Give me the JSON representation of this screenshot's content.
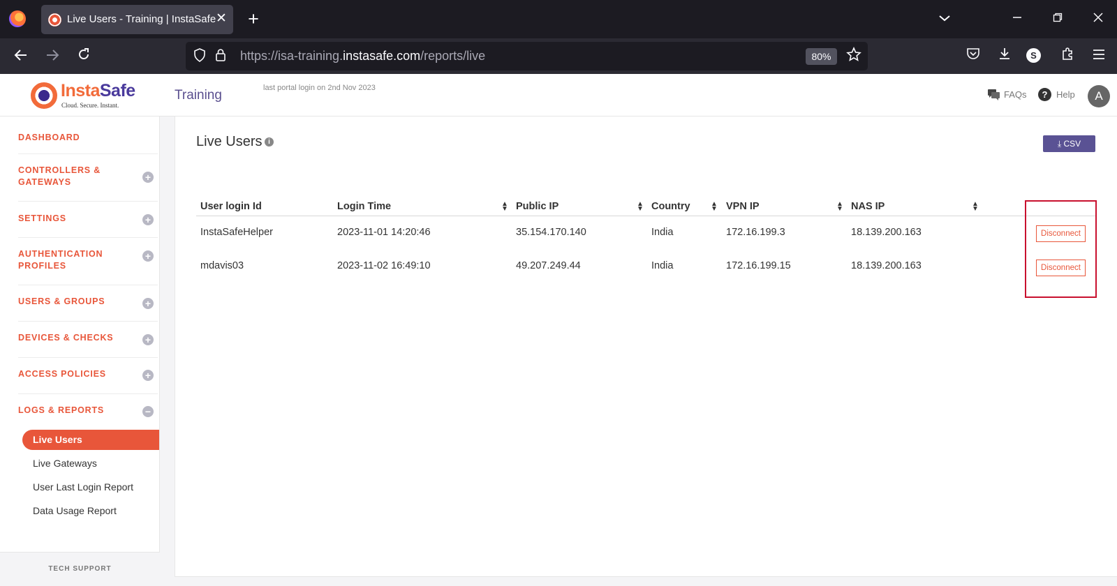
{
  "browser": {
    "tab_title": "Live Users - Training | InstaSafe",
    "tab_close": "✕",
    "new_tab": "+",
    "url_prefix": "https://isa-training.",
    "url_host": "instasafe.com",
    "url_path": "/reports/live",
    "zoom": "80%",
    "profile_initial": "S"
  },
  "header": {
    "logo_insta": "Insta",
    "logo_safe": "Safe",
    "logo_tagline": "Cloud. Secure. Instant.",
    "portal_title": "Training",
    "last_login": "last portal login on 2nd Nov 2023",
    "faqs_label": "FAQs",
    "help_label": "Help",
    "help_glyph": "?",
    "avatar_initial": "A"
  },
  "sidebar": {
    "items": [
      {
        "label": "DASHBOARD"
      },
      {
        "label": "CONTROLLERS &",
        "label2": "GATEWAYS"
      },
      {
        "label": "SETTINGS"
      },
      {
        "label": "AUTHENTICATION",
        "label2": "PROFILES"
      },
      {
        "label": "USERS & GROUPS"
      },
      {
        "label": "DEVICES & CHECKS"
      },
      {
        "label": "ACCESS POLICIES"
      },
      {
        "label": "LOGS & REPORTS"
      }
    ],
    "sub_items": [
      "Live Users",
      "Live Gateways",
      "User Last Login Report",
      "Data Usage Report"
    ],
    "tech_support": "TECH SUPPORT",
    "expand_glyph": "+",
    "collapse_glyph": "−"
  },
  "main": {
    "title": "Live Users",
    "info_glyph": "i",
    "csv_label": "⤓  CSV",
    "columns": [
      "User login Id",
      "Login Time",
      "Public IP",
      "Country",
      "VPN IP",
      "NAS IP"
    ],
    "rows": [
      {
        "user": "InstaSafeHelper",
        "login_time": "2023-11-01 14:20:46",
        "public_ip": "35.154.170.140",
        "country": "India",
        "vpn_ip": "172.16.199.3",
        "nas_ip": "18.139.200.163",
        "action": "Disconnect"
      },
      {
        "user": "mdavis03",
        "login_time": "2023-11-02 16:49:10",
        "public_ip": "49.207.249.44",
        "country": "India",
        "vpn_ip": "172.16.199.15",
        "nas_ip": "18.139.200.163",
        "action": "Disconnect"
      }
    ]
  },
  "colors": {
    "accent": "#e8563a",
    "brand_purple": "#5a5294",
    "highlight": "#c8102e"
  }
}
